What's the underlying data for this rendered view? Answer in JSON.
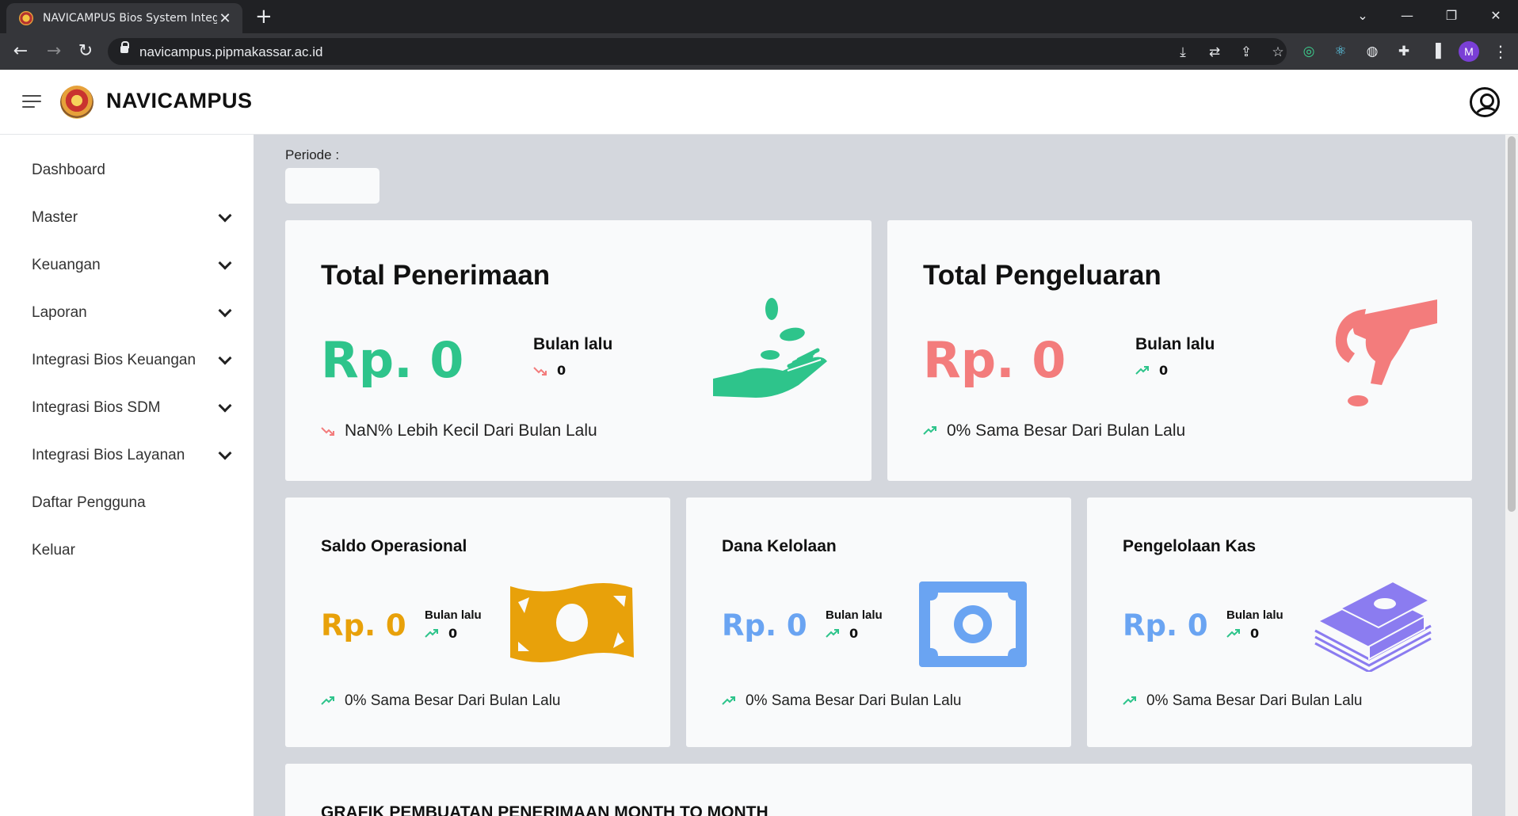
{
  "browser": {
    "tab_title": "NAVICAMPUS Bios System Integr",
    "url": "navicampus.pipmakassar.ac.id",
    "profile_initial": "M"
  },
  "header": {
    "brand": "NAVICAMPUS"
  },
  "sidebar": {
    "items": [
      {
        "label": "Dashboard",
        "has_submenu": false
      },
      {
        "label": "Master",
        "has_submenu": true
      },
      {
        "label": "Keuangan",
        "has_submenu": true
      },
      {
        "label": "Laporan",
        "has_submenu": true
      },
      {
        "label": "Integrasi Bios Keuangan",
        "has_submenu": true
      },
      {
        "label": "Integrasi Bios SDM",
        "has_submenu": true
      },
      {
        "label": "Integrasi Bios Layanan",
        "has_submenu": true
      },
      {
        "label": "Daftar Pengguna",
        "has_submenu": false
      },
      {
        "label": "Keluar",
        "has_submenu": false
      }
    ]
  },
  "periode": {
    "label": "Periode :",
    "value": ""
  },
  "cards": {
    "penerimaan": {
      "title": "Total Penerimaan",
      "amount": "Rp. 0",
      "prev_label": "Bulan lalu",
      "prev_value": "0",
      "trend": "down",
      "comparison": "NaN% Lebih Kecil Dari Bulan Lalu",
      "color": "#2ec48b"
    },
    "pengeluaran": {
      "title": "Total Pengeluaran",
      "amount": "Rp. 0",
      "prev_label": "Bulan lalu",
      "prev_value": "0",
      "trend": "up",
      "comparison": "0% Sama Besar Dari Bulan Lalu",
      "color": "#f37c7c"
    },
    "saldo": {
      "title": "Saldo Operasional",
      "amount": "Rp. 0",
      "prev_label": "Bulan lalu",
      "prev_value": "0",
      "trend": "up",
      "comparison": "0% Sama Besar Dari Bulan Lalu",
      "color": "#e8a10a"
    },
    "dana": {
      "title": "Dana Kelolaan",
      "amount": "Rp. 0",
      "prev_label": "Bulan lalu",
      "prev_value": "0",
      "trend": "up",
      "comparison": "0% Sama Besar Dari Bulan Lalu",
      "color": "#6aa4f2"
    },
    "kas": {
      "title": "Pengelolaan Kas",
      "amount": "Rp. 0",
      "prev_label": "Bulan lalu",
      "prev_value": "0",
      "trend": "up",
      "comparison": "0% Sama Besar Dari Bulan Lalu",
      "color": "#6aa4f2",
      "illustration_color": "#8b7cf0"
    }
  },
  "chart_section": {
    "title": "GRAFIK PEMBUATAN PENERIMAAN MONTH TO MONTH"
  },
  "colors": {
    "trend_up": "#2ec48b",
    "trend_down": "#f37c7c"
  }
}
